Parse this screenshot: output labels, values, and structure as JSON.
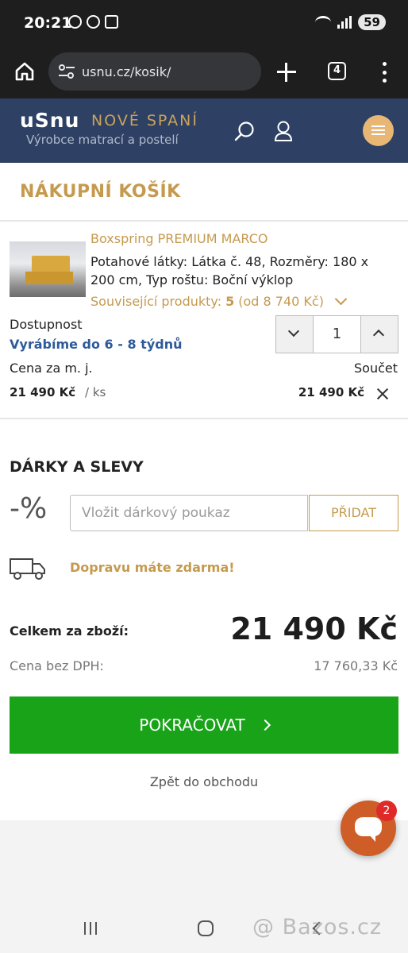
{
  "status": {
    "time": "20:21",
    "battery": "59"
  },
  "browser": {
    "url": "usnu.cz/kosik/",
    "tab_count": "4"
  },
  "site": {
    "logo": "uSnu",
    "tagline": "NOVÉ SPANÍ",
    "subline": "Výrobce matrací a postelí"
  },
  "cart": {
    "title": "NÁKUPNÍ KOŠÍK",
    "item": {
      "name": "Boxspring PREMIUM MARCO",
      "description": "Potahové látky: Látka č. 48, Rozměry: 180 x 200 cm, Typ roštu: Boční výklop",
      "related_label": "Související produkty:",
      "related_count": "5",
      "related_from": "(od 8 740 Kč)",
      "availability_label": "Dostupnost",
      "availability_value": "Vyrábíme do 6 - 8 týdnů",
      "quantity": "1",
      "unit_price_label": "Cena za m. j.",
      "sum_label": "Součet",
      "unit_price": "21 490 Kč",
      "unit_suffix": "/ ks",
      "sum_price": "21 490 Kč"
    }
  },
  "gifts": {
    "title": "DÁRKY A SLEVY",
    "percent_symbol": "-%",
    "voucher_placeholder": "Vložit dárkový poukaz",
    "add_label": "PŘIDAT",
    "shipping_note": "Dopravu máte zdarma!"
  },
  "totals": {
    "total_label": "Celkem za zboží:",
    "total_value": "21 490 Kč",
    "novat_label": "Cena bez DPH:",
    "novat_value": "17 760,33 Kč"
  },
  "actions": {
    "continue_label": "POKRAČOVAT",
    "back_label": "Zpět do obchodu"
  },
  "chat": {
    "badge": "2"
  },
  "watermark": "@ Bazos.cz",
  "colors": {
    "header_bg": "#2e4164",
    "accent_gold": "#c59a4e",
    "availability_blue": "#2e5a9a",
    "continue_green": "#19a319",
    "chat_orange": "#cf5d27"
  },
  "icons": [
    "home-icon",
    "tune-icon",
    "plus-icon",
    "tabs-icon",
    "more-icon",
    "search-icon",
    "user-icon",
    "menu-icon",
    "chevron-down-icon",
    "close-icon",
    "truck-icon",
    "chevron-right-icon",
    "chat-icon"
  ]
}
